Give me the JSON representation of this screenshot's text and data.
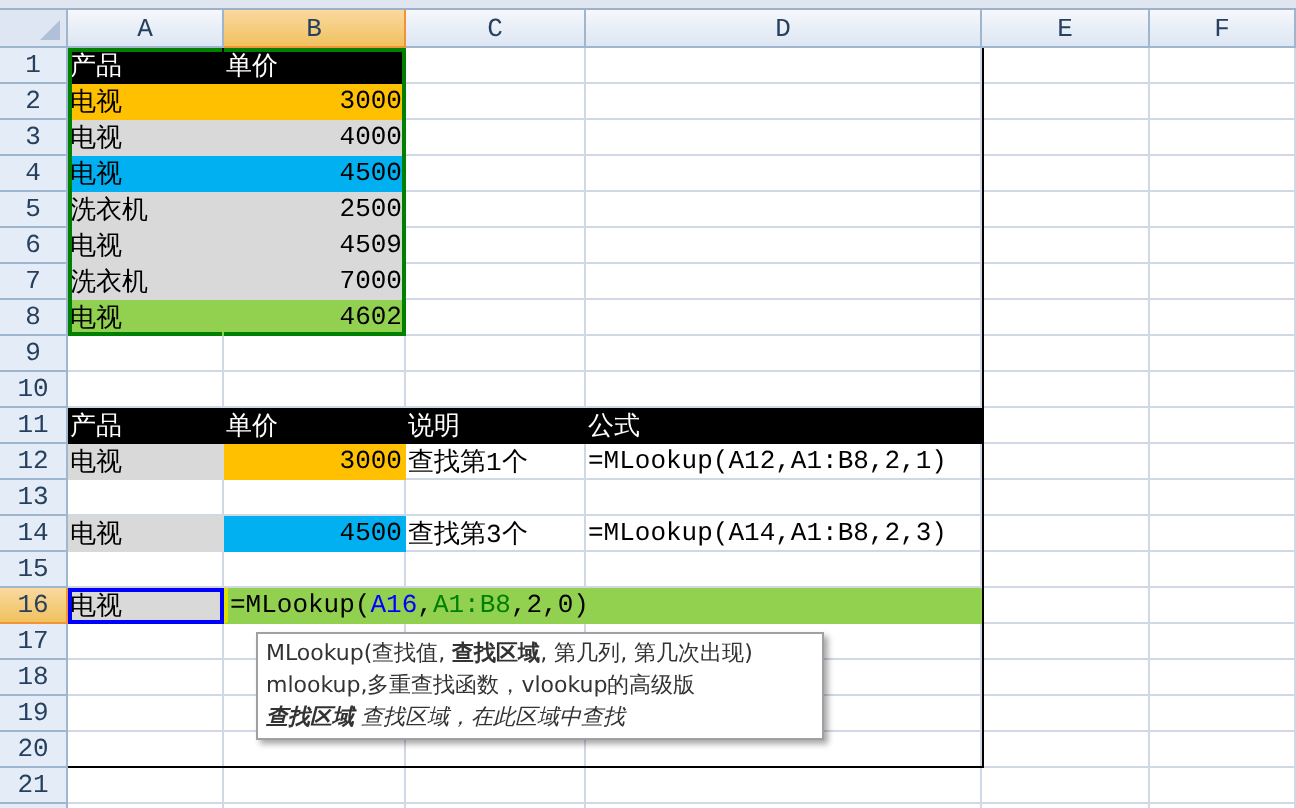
{
  "columns": [
    {
      "label": "A",
      "selected": false
    },
    {
      "label": "B",
      "selected": true
    },
    {
      "label": "C",
      "selected": false
    },
    {
      "label": "D",
      "selected": false
    },
    {
      "label": "E",
      "selected": false
    },
    {
      "label": "F",
      "selected": false
    }
  ],
  "rows": [
    {
      "label": "1",
      "selected": false,
      "cells": [
        {
          "text": "产品",
          "color": "#000000",
          "reference": {
            "color": "#008000"
          }
        },
        {
          "text": "单价",
          "color": "#000000",
          "reference": {
            "color": "#008000"
          }
        },
        {},
        {},
        {},
        {}
      ]
    },
    {
      "label": "2",
      "selected": false,
      "cells": [
        {
          "text": "电视",
          "color": "#ffc000",
          "reference": {
            "color": "#008000"
          }
        },
        {
          "text": "3000",
          "color": "#ffc000",
          "kind": "number",
          "reference": {
            "color": "#008000"
          }
        },
        {},
        {},
        {},
        {}
      ]
    },
    {
      "label": "3",
      "selected": false,
      "cells": [
        {
          "text": "电视",
          "color": "#d9d9d9",
          "reference": {
            "color": "#008000"
          }
        },
        {
          "text": "4000",
          "color": "#d9d9d9",
          "kind": "number",
          "reference": {
            "color": "#008000"
          }
        },
        {},
        {},
        {},
        {}
      ]
    },
    {
      "label": "4",
      "selected": false,
      "cells": [
        {
          "text": "电视",
          "color": "#00b0f0",
          "reference": {
            "color": "#008000"
          }
        },
        {
          "text": "4500",
          "color": "#00b0f0",
          "kind": "number",
          "reference": {
            "color": "#008000"
          }
        },
        {},
        {},
        {},
        {}
      ]
    },
    {
      "label": "5",
      "selected": false,
      "cells": [
        {
          "text": "洗衣机",
          "color": "#d9d9d9",
          "reference": {
            "color": "#008000"
          }
        },
        {
          "text": "2500",
          "color": "#d9d9d9",
          "kind": "number",
          "reference": {
            "color": "#008000"
          }
        },
        {},
        {},
        {},
        {}
      ]
    },
    {
      "label": "6",
      "selected": false,
      "cells": [
        {
          "text": "电视",
          "color": "#d9d9d9",
          "reference": {
            "color": "#008000"
          }
        },
        {
          "text": "4509",
          "color": "#d9d9d9",
          "kind": "number",
          "reference": {
            "color": "#008000"
          }
        },
        {},
        {},
        {},
        {}
      ]
    },
    {
      "label": "7",
      "selected": false,
      "cells": [
        {
          "text": "洗衣机",
          "color": "#d9d9d9",
          "reference": {
            "color": "#008000"
          }
        },
        {
          "text": "7000",
          "color": "#d9d9d9",
          "kind": "number",
          "reference": {
            "color": "#008000"
          }
        },
        {},
        {},
        {},
        {}
      ]
    },
    {
      "label": "8",
      "selected": false,
      "cells": [
        {
          "text": "电视",
          "color": "#92d050",
          "reference": {
            "color": "#008000"
          }
        },
        {
          "text": "4602",
          "color": "#92d050",
          "kind": "number",
          "reference": {
            "color": "#008000"
          }
        },
        {},
        {},
        {},
        {}
      ]
    },
    {
      "label": "9",
      "selected": false,
      "cells": [
        {},
        {},
        {},
        {},
        {},
        {}
      ]
    },
    {
      "label": "10",
      "selected": false,
      "cells": [
        {},
        {},
        {},
        {},
        {},
        {}
      ]
    },
    {
      "label": "11",
      "selected": false,
      "cells": [
        {
          "text": "产品",
          "color": "#000000"
        },
        {
          "text": "单价",
          "color": "#000000"
        },
        {
          "text": "说明",
          "color": "#000000"
        },
        {
          "text": "公式",
          "color": "#000000"
        },
        {},
        {}
      ]
    },
    {
      "label": "12",
      "selected": false,
      "cells": [
        {
          "text": "电视",
          "color": "#d9d9d9"
        },
        {
          "text": "3000",
          "color": "#ffc000",
          "kind": "number"
        },
        {
          "text": "查找第1个"
        },
        {
          "text": "=MLookup(A12,A1:B8,2,1)"
        },
        {},
        {}
      ]
    },
    {
      "label": "13",
      "selected": false,
      "cells": [
        {},
        {},
        {},
        {},
        {},
        {}
      ]
    },
    {
      "label": "14",
      "selected": false,
      "cells": [
        {
          "text": "电视",
          "color": "#d9d9d9"
        },
        {
          "text": "4500",
          "color": "#00b0f0",
          "kind": "number"
        },
        {
          "text": "查找第3个"
        },
        {
          "text": "=MLookup(A14,A1:B8,2,3)"
        },
        {},
        {}
      ]
    },
    {
      "label": "15",
      "selected": false,
      "cells": [
        {},
        {},
        {},
        {},
        {},
        {}
      ]
    },
    {
      "label": "16",
      "selected": true,
      "cells": [
        {
          "text": "电视",
          "color": "#d9d9d9",
          "reference": {
            "color": "#0000ff"
          }
        },
        {
          "kind": "editing",
          "color": "#92d050",
          "segments": [
            {
              "text": "=MLookup(",
              "color": "#000000"
            },
            {
              "text": "A16",
              "color": "#0000ff"
            },
            {
              "text": ",",
              "color": "#000000"
            },
            {
              "text": "A1:B8",
              "color": "#008000"
            },
            {
              "text": ",2,0)",
              "color": "#000000"
            }
          ]
        },
        {},
        {}
      ]
    },
    {
      "label": "17",
      "selected": false,
      "cells": [
        {},
        {},
        {},
        {},
        {},
        {}
      ]
    },
    {
      "label": "18",
      "selected": false,
      "cells": [
        {},
        {},
        {},
        {},
        {},
        {}
      ]
    },
    {
      "label": "19",
      "selected": false,
      "cells": [
        {},
        {},
        {},
        {},
        {},
        {}
      ]
    },
    {
      "label": "20",
      "selected": false,
      "cells": [
        {},
        {},
        {},
        {},
        {},
        {}
      ]
    },
    {
      "label": "21",
      "selected": false,
      "cells": [
        {},
        {},
        {},
        {},
        {},
        {}
      ]
    }
  ],
  "tooltip": {
    "signature": "MLookup(查找值, **查找区域**, 第几列, 第几次出现)",
    "description": "mlookup,多重查找函数，vlookup的高级版",
    "argument_help": "**查找区域** 查找区域，在此区域中查找"
  }
}
